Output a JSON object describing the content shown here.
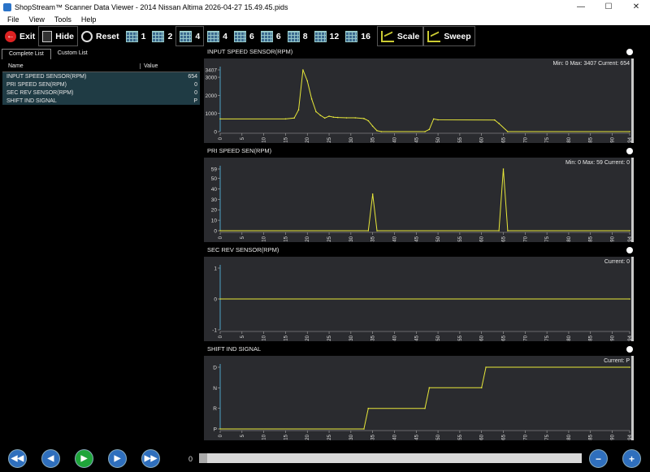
{
  "window": {
    "title": "ShopStream™ Scanner Data Viewer - 2014 Nissan Altima 2026-04-27 15.49.45.pids",
    "minimize": "—",
    "maximize": "☐",
    "close": "✕"
  },
  "menu": [
    "File",
    "View",
    "Tools",
    "Help"
  ],
  "toolbar": {
    "exit": "Exit",
    "hide": "Hide",
    "reset": "Reset",
    "layouts": [
      "1",
      "2",
      "4",
      "4",
      "6",
      "6",
      "8",
      "12",
      "16"
    ],
    "scale": "Scale",
    "sweep": "Sweep"
  },
  "left_panel": {
    "tabs": [
      "Complete List",
      "Custom List"
    ],
    "columns": {
      "name": "Name",
      "value": "Value"
    },
    "rows": [
      {
        "name": "INPUT SPEED SENSOR(RPM)",
        "value": "654"
      },
      {
        "name": "PRI SPEED SEN(RPM)",
        "value": "0"
      },
      {
        "name": "SEC REV SENSOR(RPM)",
        "value": "0"
      },
      {
        "name": "SHIFT IND SIGNAL",
        "value": "P"
      }
    ]
  },
  "colors": {
    "trace": "#e8e83a",
    "panel_bg": "#2a2b2f",
    "axis": "#aaaaaa"
  },
  "chart_data": [
    {
      "type": "line",
      "title": "INPUT SPEED SENSOR(RPM)",
      "stats": {
        "min": "Min: 0",
        "max": "Max: 3407",
        "current": "Current: 654"
      },
      "ylim": [
        0,
        3407
      ],
      "yticks": [
        "0",
        "1000",
        "2000",
        "3000",
        "3407"
      ],
      "ytick_values": [
        0,
        1000,
        2000,
        3000,
        3407
      ],
      "xlim": [
        0,
        94
      ],
      "xticks": [
        0,
        5,
        10,
        15,
        20,
        25,
        30,
        35,
        40,
        45,
        50,
        55,
        60,
        65,
        70,
        75,
        80,
        85,
        90,
        94
      ],
      "x": [
        0,
        15,
        17,
        18,
        19,
        20,
        21,
        22,
        23,
        24,
        25,
        26,
        27,
        29,
        31,
        33,
        34,
        35,
        36,
        37,
        47,
        48,
        49,
        50,
        63,
        64,
        66,
        94
      ],
      "y": [
        700,
        700,
        750,
        1200,
        3407,
        2800,
        1800,
        1100,
        900,
        750,
        850,
        800,
        780,
        760,
        760,
        720,
        600,
        300,
        50,
        0,
        0,
        120,
        700,
        650,
        640,
        450,
        0,
        0
      ]
    },
    {
      "type": "line",
      "title": "PRI SPEED SEN(RPM)",
      "stats": {
        "min": "Min: 0",
        "max": "Max: 59",
        "current": "Current: 0"
      },
      "ylim": [
        0,
        59
      ],
      "yticks": [
        "0",
        "10",
        "20",
        "30",
        "40",
        "50",
        "59"
      ],
      "ytick_values": [
        0,
        10,
        20,
        30,
        40,
        50,
        59
      ],
      "xlim": [
        0,
        94
      ],
      "xticks": [
        0,
        5,
        10,
        15,
        20,
        25,
        30,
        35,
        40,
        45,
        50,
        55,
        60,
        65,
        70,
        75,
        80,
        85,
        90,
        94
      ],
      "x": [
        0,
        34,
        35,
        36,
        64,
        65,
        66,
        94
      ],
      "y": [
        0,
        0,
        35,
        0,
        0,
        59,
        0,
        0
      ]
    },
    {
      "type": "line",
      "title": "SEC REV SENSOR(RPM)",
      "stats": {
        "current": "Current: 0"
      },
      "ylim": [
        -1,
        1
      ],
      "yticks": [
        "-1",
        "0",
        "1"
      ],
      "ytick_values": [
        -1,
        0,
        1
      ],
      "xlim": [
        0,
        94
      ],
      "xticks": [
        0,
        5,
        10,
        15,
        20,
        25,
        30,
        35,
        40,
        45,
        50,
        55,
        60,
        65,
        70,
        75,
        80,
        85,
        90,
        94
      ],
      "x": [
        0,
        94
      ],
      "y": [
        0,
        0
      ]
    },
    {
      "type": "line",
      "title": "SHIFT IND SIGNAL",
      "stats": {
        "current": "Current: P"
      },
      "ylim": [
        0,
        3
      ],
      "yticks": [
        "P",
        "R",
        "N",
        "D"
      ],
      "ytick_values": [
        0,
        1,
        2,
        3
      ],
      "xlim": [
        0,
        94
      ],
      "xticks": [
        0,
        5,
        10,
        15,
        20,
        25,
        30,
        35,
        40,
        45,
        50,
        55,
        60,
        65,
        70,
        75,
        80,
        85,
        90,
        94
      ],
      "x": [
        0,
        33,
        34,
        47,
        48,
        60,
        61,
        94
      ],
      "y": [
        0,
        0,
        1,
        1,
        2,
        2,
        3,
        3
      ]
    }
  ],
  "bottom": {
    "scroll_start": "0"
  }
}
